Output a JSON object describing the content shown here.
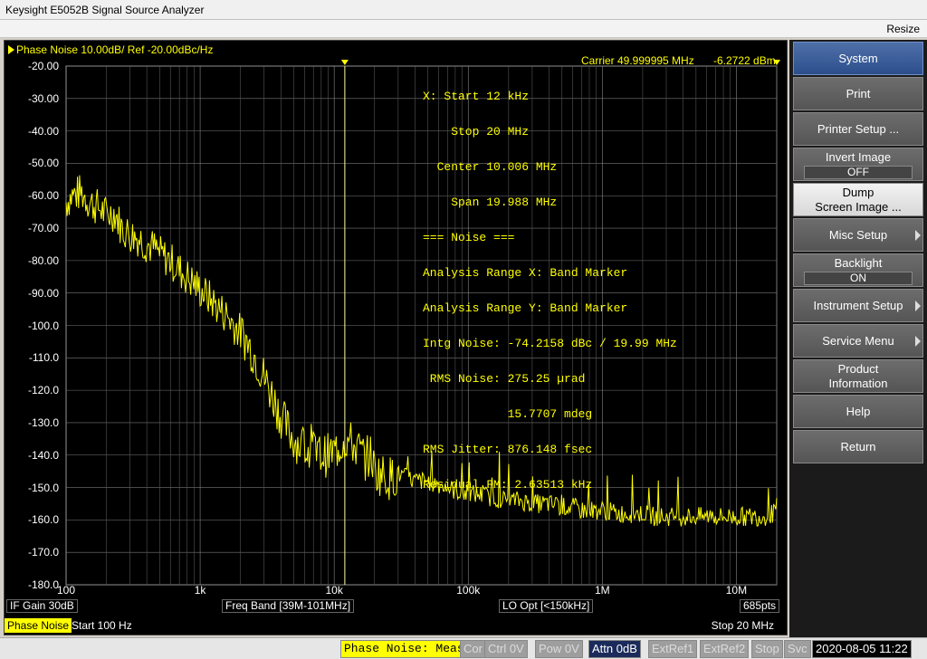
{
  "window": {
    "title": "Keysight E5052B Signal Source Analyzer",
    "resize_label": "Resize"
  },
  "trace": {
    "header": "Phase Noise 10.00dB/ Ref -20.00dBc/Hz",
    "carrier_label": "Carrier 49.999995 MHz",
    "carrier_level": "-6.2722 dBm"
  },
  "axes": {
    "y_ticks": [
      "-20.00",
      "-30.00",
      "-40.00",
      "-50.00",
      "-60.00",
      "-70.00",
      "-80.00",
      "-90.00",
      "-100.0",
      "-110.0",
      "-120.0",
      "-130.0",
      "-140.0",
      "-150.0",
      "-160.0",
      "-170.0",
      "-180.0"
    ],
    "x_ticks": [
      "100",
      "1k",
      "10k",
      "100k",
      "1M",
      "10M"
    ]
  },
  "measurement": [
    "X: Start 12 kHz",
    "    Stop 20 MHz",
    "  Center 10.006 MHz",
    "    Span 19.988 MHz",
    "=== Noise ===",
    "Analysis Range X: Band Marker",
    "Analysis Range Y: Band Marker",
    "Intg Noise: -74.2158 dBc / 19.99 MHz",
    " RMS Noise: 275.25 µrad",
    "            15.7707 mdeg",
    "RMS Jitter: 876.148 fsec",
    "Residual FM: 2.63513 kHz"
  ],
  "status": {
    "if_gain": "IF Gain 30dB",
    "freq_band": "Freq Band [39M-101MHz]",
    "lo_opt": "LO Opt [<150kHz]",
    "points": "685pts"
  },
  "sweep": {
    "tag": "Phase Noise",
    "start": "Start 100 Hz",
    "stop": "Stop 20 MHz"
  },
  "softkeys": {
    "system": "System",
    "print": "Print",
    "printer_setup": "Printer Setup ...",
    "invert_image": "Invert Image",
    "invert_value": "OFF",
    "dump_line1": "Dump",
    "dump_line2": "Screen Image ...",
    "misc_setup": "Misc Setup",
    "backlight": "Backlight",
    "backlight_value": "ON",
    "instrument_setup": "Instrument Setup",
    "service_menu": "Service Menu",
    "product_line1": "Product",
    "product_line2": "Information",
    "help": "Help",
    "return": "Return"
  },
  "bottom": {
    "meas": "Phase Noise: Meas",
    "cor": "Cor",
    "ctrl": "Ctrl 0V",
    "pow": "Pow 0V",
    "attn": "Attn 0dB",
    "extref1": "ExtRef1",
    "extref2": "ExtRef2",
    "stop": "Stop",
    "svc": "Svc",
    "datetime": "2020-08-05 11:22"
  },
  "chart_data": {
    "type": "line",
    "title": "Phase Noise 10.00dB/ Ref -20.00dBc/Hz",
    "xlabel": "",
    "ylabel": "",
    "x_scale": "log",
    "xlim": [
      100,
      20000000
    ],
    "ylim": [
      -180,
      -20
    ],
    "grid": true,
    "trace_color": "#ffff00",
    "band_marker_x": 12000,
    "band_marker_x_end": 20000000,
    "series": [
      {
        "x": [
          100,
          110,
          130,
          150,
          180,
          200,
          230,
          260,
          300,
          350,
          400,
          450,
          500,
          600,
          700,
          800,
          900,
          1000,
          1200,
          1400,
          1600,
          1800,
          2000,
          2300,
          2600,
          3000,
          3500,
          4000,
          4500,
          5000,
          6000,
          7000,
          8000,
          9000,
          10000,
          11000,
          12000,
          13000,
          15000,
          17000,
          19000,
          20000,
          23000,
          26000,
          30000,
          35000,
          40000,
          50000,
          60000,
          70000,
          80000,
          100000,
          120000,
          150000,
          200000,
          250000,
          300000,
          400000,
          500000,
          600000,
          700000,
          800000,
          1000000,
          1300000,
          1600000,
          2000000,
          2500000,
          3000000,
          4000000,
          5000000,
          6000000,
          6500000,
          7000000,
          8000000,
          10000000,
          13000000,
          16000000,
          19000000,
          20000000
        ],
        "y": [
          -62,
          -60,
          -59,
          -62,
          -64,
          -66,
          -65,
          -70,
          -72,
          -73,
          -75,
          -76,
          -78,
          -80,
          -83,
          -85,
          -87,
          -89,
          -92,
          -95,
          -97,
          -100,
          -102,
          -106,
          -110,
          -116,
          -122,
          -128,
          -132,
          -135,
          -138,
          -139,
          -140,
          -140,
          -139,
          -137,
          -135,
          -136,
          -138,
          -141,
          -140,
          -145,
          -146,
          -147,
          -146,
          -147,
          -148,
          -148,
          -149,
          -150,
          -151,
          -152,
          -152,
          -153,
          -154,
          -154,
          -155,
          -155,
          -156,
          -156,
          -157,
          -157,
          -157,
          -158,
          -158,
          -158,
          -159,
          -159,
          -159,
          -159,
          -159,
          -158,
          -159,
          -159,
          -159,
          -159,
          -159,
          -158,
          -156
        ]
      }
    ]
  }
}
